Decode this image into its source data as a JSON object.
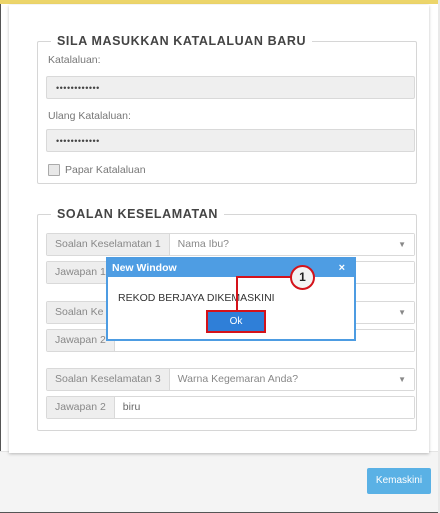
{
  "password_section": {
    "legend": "SILA MASUKKAN KATALALUAN BARU",
    "password_label": "Katalaluan:",
    "password_value": "••••••••••••",
    "confirm_label": "Ulang Katalaluan:",
    "confirm_value": "••••••••••••",
    "show_password_label": "Papar Katalaluan"
  },
  "security_section": {
    "legend": "SOALAN KESELAMATAN",
    "rows": [
      {
        "addon": "Soalan Keselamatan 1",
        "value": "Nama Ibu?",
        "type": "select"
      },
      {
        "addon": "Jawapan 1",
        "value": "",
        "type": "input"
      },
      {
        "addon": "Soalan Ke",
        "value": "",
        "type": "select"
      },
      {
        "addon": "Jawapan 2",
        "value": "",
        "type": "input"
      },
      {
        "addon": "Soalan Keselamatan 3",
        "value": "Warna Kegemaran Anda?",
        "type": "select"
      },
      {
        "addon": "Jawapan 2",
        "value": "biru",
        "type": "input"
      }
    ]
  },
  "footer": {
    "update_button": "Kemaskini"
  },
  "dialog": {
    "title": "New Window",
    "close": "×",
    "message": "REKOD BERJAYA DIKEMASKINI",
    "ok_button": "Ok"
  },
  "callout": {
    "number": "1"
  },
  "icons": {
    "caret": "▼"
  },
  "colors": {
    "accent_blue": "#4e9de3",
    "ok_blue": "#2f7fd8",
    "highlight_red": "#d4121a",
    "update_blue": "#5ab1e5"
  }
}
